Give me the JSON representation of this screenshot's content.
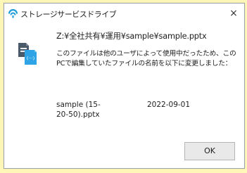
{
  "colors": {
    "page_background": "#fff7b8",
    "dialog_background": "#ffffff",
    "brand_accent": "#1a9bd7",
    "icon_dark": "#4b5a6b",
    "icon_accent": "#2ea3e6",
    "button_background": "#e9e9e9"
  },
  "window": {
    "title": "ストレージサービスドライブ",
    "close_label": "×"
  },
  "icons": {
    "title_logo": "storage-drive-logo-icon",
    "file_conflict": "file-conflict-icon"
  },
  "message": {
    "path": "Z:¥全社共有¥運用¥sample¥sample.pptx",
    "body": "このファイルは他のユーザによって使用中だったため、このPCで編集していたファイルの名前を以下に変更しました：",
    "renamed_file": "sample (15-20-50).pptx",
    "renamed_date": "2022-09-01"
  },
  "buttons": {
    "ok_label": "OK"
  }
}
